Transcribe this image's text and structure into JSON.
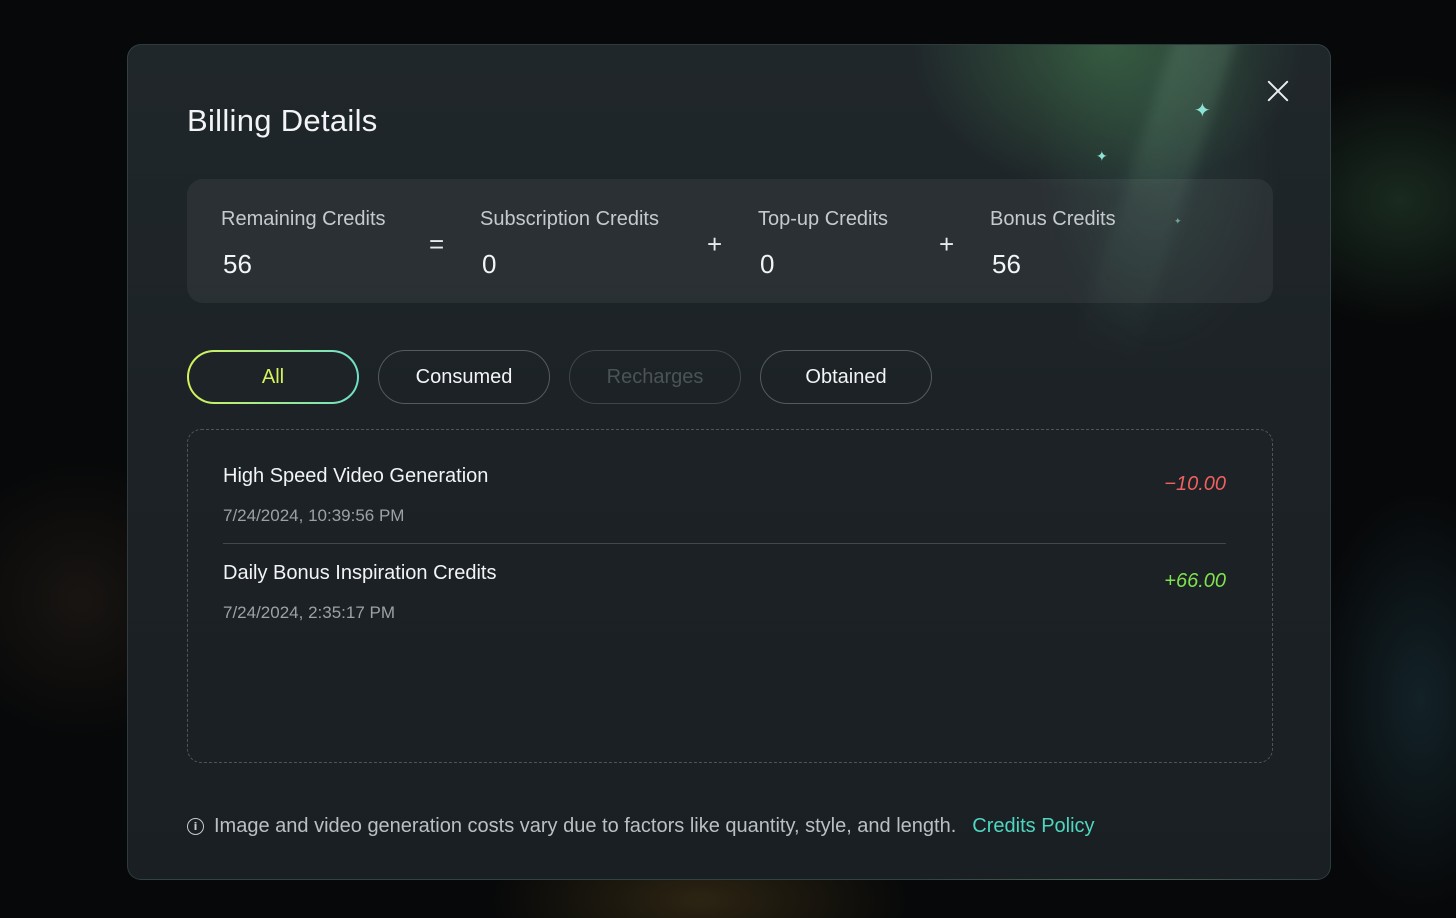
{
  "modal": {
    "title": "Billing Details",
    "close_icon": "close-icon"
  },
  "credits": {
    "remaining": {
      "label": "Remaining Credits",
      "value": "56"
    },
    "subscription": {
      "label": "Subscription Credits",
      "value": "0"
    },
    "topup": {
      "label": "Top-up Credits",
      "value": "0"
    },
    "bonus": {
      "label": "Bonus Credits",
      "value": "56"
    },
    "operators": {
      "equals": "=",
      "plus": "+"
    }
  },
  "tabs": [
    {
      "label": "All",
      "state": "active"
    },
    {
      "label": "Consumed",
      "state": "normal"
    },
    {
      "label": "Recharges",
      "state": "disabled"
    },
    {
      "label": "Obtained",
      "state": "normal"
    }
  ],
  "transactions": [
    {
      "title": "High Speed Video Generation",
      "date": "7/24/2024, 10:39:56 PM",
      "amount": "−10.00",
      "type": "negative"
    },
    {
      "title": "Daily Bonus Inspiration Credits",
      "date": "7/24/2024, 2:35:17 PM",
      "amount": "+66.00",
      "type": "positive"
    }
  ],
  "footer": {
    "info_icon": "info-icon",
    "note": "Image and video generation costs vary due to factors like quantity, style, and length.",
    "link": "Credits Policy"
  },
  "colors": {
    "accent_active_tab": "#d6f25c",
    "negative_amount": "#f0605e",
    "positive_amount": "#7fe14e",
    "link": "#4fd6c0"
  }
}
